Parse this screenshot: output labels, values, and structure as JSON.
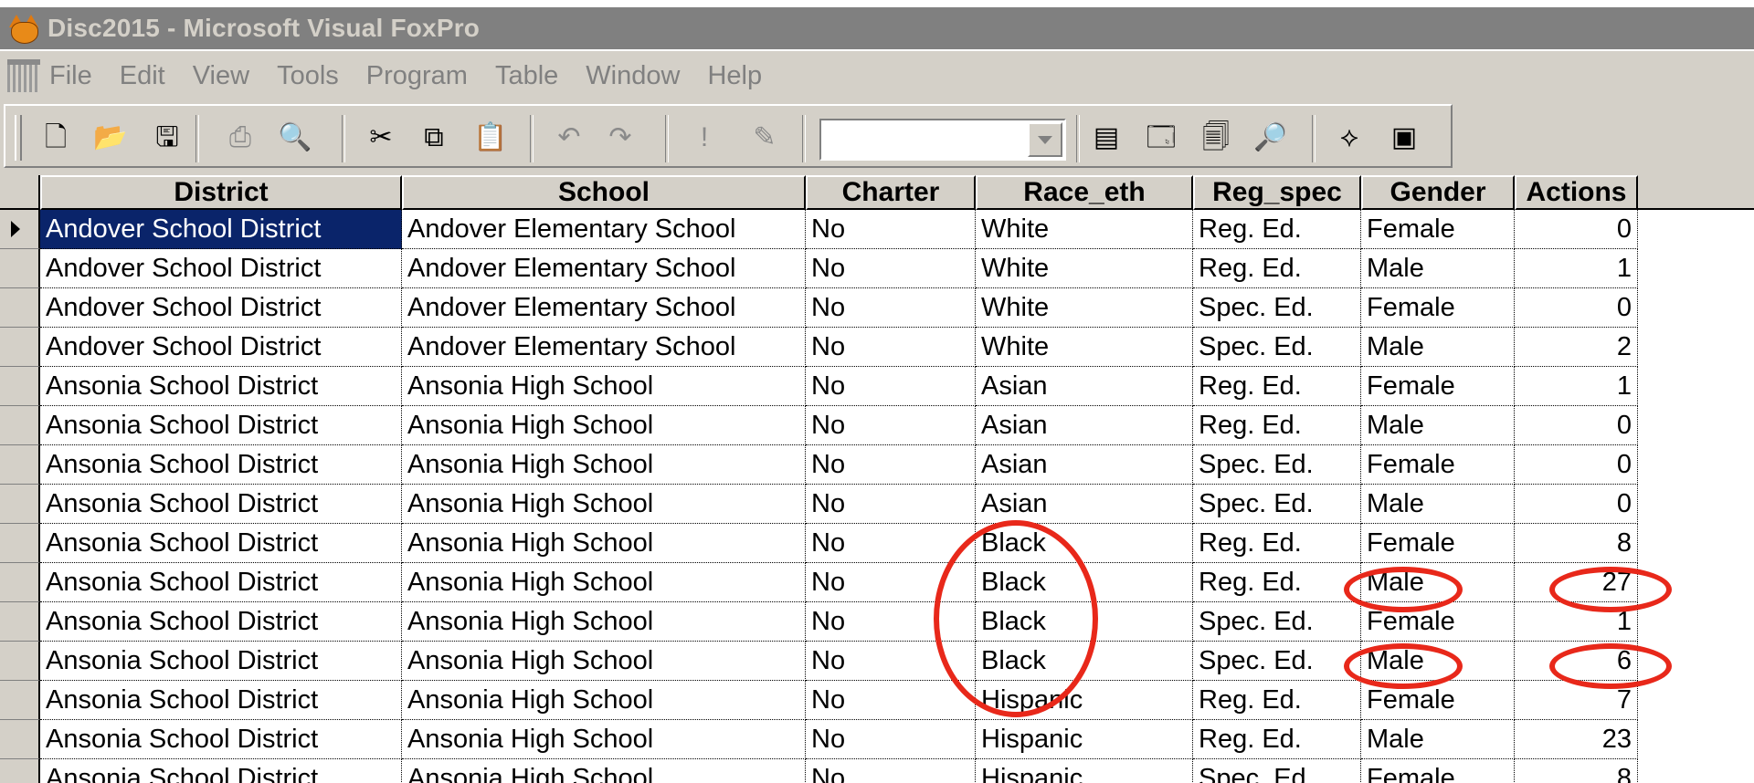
{
  "window": {
    "title": "Disc2015 - Microsoft Visual FoxPro",
    "app_icon": "foxpro-icon"
  },
  "menu": {
    "items": [
      "File",
      "Edit",
      "View",
      "Tools",
      "Program",
      "Table",
      "Window",
      "Help"
    ]
  },
  "toolbar": {
    "combo_value": "",
    "buttons": [
      "new-file-icon",
      "open-folder-icon",
      "save-icon",
      "print-icon",
      "print-preview-icon",
      "cut-icon",
      "copy-icon",
      "paste-icon",
      "undo-icon",
      "redo-icon",
      "run-icon",
      "modify-form-icon",
      "command-window-icon",
      "data-session-icon",
      "properties-icon",
      "form-designer-icon",
      "class-browser-icon",
      "component-gallery-icon"
    ]
  },
  "grid": {
    "columns": [
      "District",
      "School",
      "Charter",
      "Race_eth",
      "Reg_spec",
      "Gender",
      "Actions"
    ],
    "rows": [
      [
        "Andover School District",
        "Andover Elementary School",
        "No",
        "White",
        "Reg. Ed.",
        "Female",
        "0"
      ],
      [
        "Andover School District",
        "Andover Elementary School",
        "No",
        "White",
        "Reg. Ed.",
        "Male",
        "1"
      ],
      [
        "Andover School District",
        "Andover Elementary School",
        "No",
        "White",
        "Spec. Ed.",
        "Female",
        "0"
      ],
      [
        "Andover School District",
        "Andover Elementary School",
        "No",
        "White",
        "Spec. Ed.",
        "Male",
        "2"
      ],
      [
        "Ansonia School District",
        "Ansonia High School",
        "No",
        "Asian",
        "Reg. Ed.",
        "Female",
        "1"
      ],
      [
        "Ansonia School District",
        "Ansonia High School",
        "No",
        "Asian",
        "Reg. Ed.",
        "Male",
        "0"
      ],
      [
        "Ansonia School District",
        "Ansonia High School",
        "No",
        "Asian",
        "Spec. Ed.",
        "Female",
        "0"
      ],
      [
        "Ansonia School District",
        "Ansonia High School",
        "No",
        "Asian",
        "Spec. Ed.",
        "Male",
        "0"
      ],
      [
        "Ansonia School District",
        "Ansonia High School",
        "No",
        "Black",
        "Reg. Ed.",
        "Female",
        "8"
      ],
      [
        "Ansonia School District",
        "Ansonia High School",
        "No",
        "Black",
        "Reg. Ed.",
        "Male",
        "27"
      ],
      [
        "Ansonia School District",
        "Ansonia High School",
        "No",
        "Black",
        "Spec. Ed.",
        "Female",
        "1"
      ],
      [
        "Ansonia School District",
        "Ansonia High School",
        "No",
        "Black",
        "Spec. Ed.",
        "Male",
        "6"
      ],
      [
        "Ansonia School District",
        "Ansonia High School",
        "No",
        "Hispanic",
        "Reg. Ed.",
        "Female",
        "7"
      ],
      [
        "Ansonia School District",
        "Ansonia High School",
        "No",
        "Hispanic",
        "Reg. Ed.",
        "Male",
        "23"
      ],
      [
        "Ansonia School District",
        "Ansonia High School",
        "No",
        "Hispanic",
        "Spec. Ed.",
        "Female",
        "8"
      ]
    ],
    "selected_row": 0,
    "selection_color": "#0a246a"
  },
  "annotations": {
    "color": "#e8281a"
  }
}
